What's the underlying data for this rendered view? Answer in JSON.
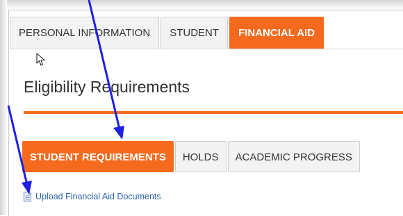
{
  "main_tabs": [
    {
      "label": "PERSONAL INFORMATION",
      "active": false
    },
    {
      "label": "STUDENT",
      "active": false
    },
    {
      "label": "FINANCIAL AID",
      "active": true
    }
  ],
  "section": {
    "heading": "Eligibility Requirements"
  },
  "sub_tabs": [
    {
      "label": "STUDENT REQUIREMENTS",
      "active": true
    },
    {
      "label": "HOLDS",
      "active": false
    },
    {
      "label": "ACADEMIC PROGRESS",
      "active": false
    }
  ],
  "upload_link": {
    "label": "Upload Financial Aid Documents",
    "icon": "document-icon"
  },
  "colors": {
    "accent": "#f56a1c",
    "annotation_arrow": "#1e1ee6",
    "link": "#2a64b0"
  }
}
